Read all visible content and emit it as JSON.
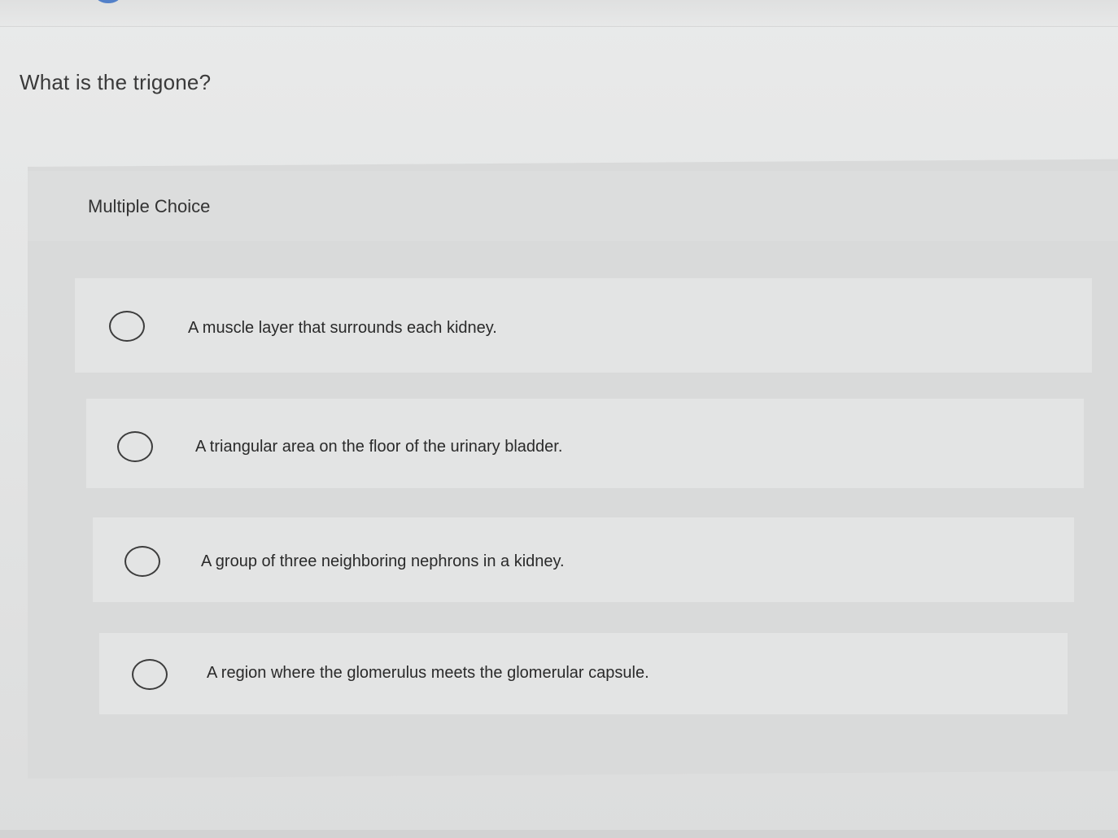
{
  "question": {
    "text": "What is the trigone?"
  },
  "multiple_choice": {
    "label": "Multiple Choice",
    "options": [
      {
        "text": "A muscle layer that surrounds each kidney.",
        "selected": false
      },
      {
        "text": "A triangular area on the floor of the urinary bladder.",
        "selected": false
      },
      {
        "text": "A group of three neighboring nephrons in a kidney.",
        "selected": false
      },
      {
        "text": "A region where the glomerulus meets the glomerular capsule.",
        "selected": false
      }
    ]
  },
  "colors": {
    "background": "#e6e7e7",
    "panel": "#d9dada",
    "option_row": "#e3e4e4",
    "text": "#2a2a2a"
  }
}
